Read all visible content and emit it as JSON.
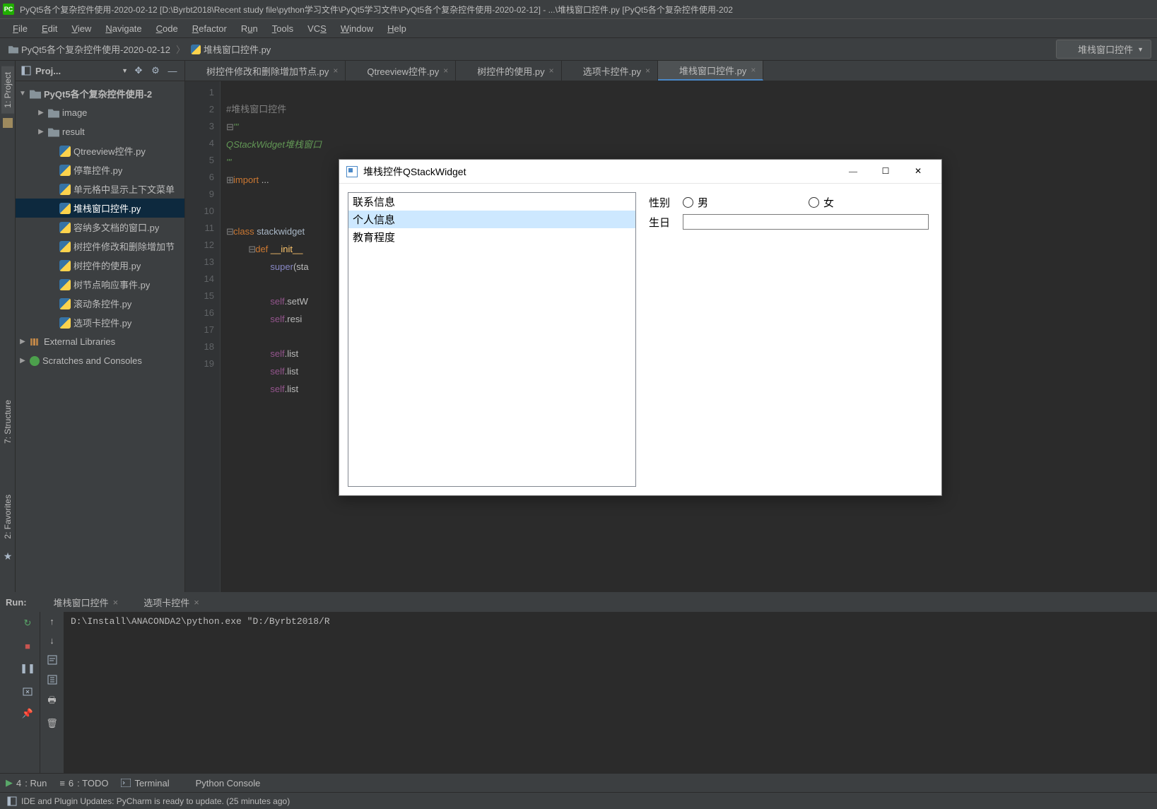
{
  "titlebar": {
    "app_icon": "PC",
    "text": "PyQt5各个复杂控件使用-2020-02-12 [D:\\Byrbt2018\\Recent study file\\python学习文件\\PyQt5学习文件\\PyQt5各个复杂控件使用-2020-02-12] - ...\\堆栈窗口控件.py [PyQt5各个复杂控件使用-202"
  },
  "menu": {
    "file": "File",
    "edit": "Edit",
    "view": "View",
    "navigate": "Navigate",
    "code": "Code",
    "refactor": "Refactor",
    "run": "Run",
    "tools": "Tools",
    "vcs": "VCS",
    "window": "Window",
    "help": "Help"
  },
  "breadcrumb": {
    "root": "PyQt5各个复杂控件使用-2020-02-12",
    "file": "堆栈窗口控件.py"
  },
  "run_config": {
    "selected": "堆栈窗口控件"
  },
  "left_tools": {
    "project": "1: Project",
    "structure": "7: Structure",
    "favorites": "2: Favorites"
  },
  "project_panel": {
    "header": "Proj..."
  },
  "tree": {
    "root": "PyQt5各个复杂控件使用-2",
    "items": [
      {
        "label": "image",
        "type": "folder",
        "indent": 1,
        "expander": "▶"
      },
      {
        "label": "result",
        "type": "folder",
        "indent": 1,
        "expander": "▶"
      },
      {
        "label": "Qtreeview控件.py",
        "type": "py",
        "indent": 2
      },
      {
        "label": "停靠控件.py",
        "type": "py",
        "indent": 2
      },
      {
        "label": "单元格中显示上下文菜单",
        "type": "py",
        "indent": 2
      },
      {
        "label": "堆栈窗口控件.py",
        "type": "py",
        "indent": 2,
        "selected": true
      },
      {
        "label": "容纳多文档的窗口.py",
        "type": "py",
        "indent": 2
      },
      {
        "label": "树控件修改和删除增加节",
        "type": "py",
        "indent": 2
      },
      {
        "label": "树控件的使用.py",
        "type": "py",
        "indent": 2
      },
      {
        "label": "树节点响应事件.py",
        "type": "py",
        "indent": 2
      },
      {
        "label": "滚动条控件.py",
        "type": "py",
        "indent": 2
      },
      {
        "label": "选项卡控件.py",
        "type": "py",
        "indent": 2
      }
    ],
    "external": "External Libraries",
    "scratches": "Scratches and Consoles"
  },
  "editor_tabs": [
    {
      "label": "树控件修改和删除增加节点.py"
    },
    {
      "label": "Qtreeview控件.py"
    },
    {
      "label": "树控件的使用.py"
    },
    {
      "label": "选项卡控件.py"
    },
    {
      "label": "堆栈窗口控件.py",
      "active": true
    }
  ],
  "editor": {
    "lines": [
      1,
      2,
      3,
      4,
      5,
      6,
      9,
      10,
      11,
      12,
      13,
      14,
      15,
      16,
      17,
      18,
      19
    ],
    "code": {
      "l1": "#堆栈窗口控件",
      "l2": "'''",
      "l3": "QStackWidget堆栈窗口",
      "l4": "'''",
      "l5_kw": "import",
      "l5_rest": " ...",
      "l10_kw": "class",
      "l10_name": " stackwidget",
      "l11_kw": "def",
      "l11_func": " __init__",
      "l12_super": "super",
      "l12_rest": "(sta",
      "l14_self": "self",
      "l14_call": ".setW",
      "l15_self": "self",
      "l15_call": ".resi",
      "l17_self": "self",
      "l17_call": ".list",
      "l18_self": "self",
      "l18_call": ".list",
      "l19_self": "self",
      "l19_call": ".list"
    }
  },
  "run": {
    "header": "Run:",
    "tabs": [
      {
        "label": "堆栈窗口控件"
      },
      {
        "label": "选项卡控件"
      }
    ],
    "output": "D:\\Install\\ANACONDA2\\python.exe \"D:/Byrbt2018/R"
  },
  "bottom": {
    "run": "4: Run",
    "todo": "6: TODO",
    "terminal": "Terminal",
    "pyconsole": "Python Console"
  },
  "status": {
    "text": "IDE and Plugin Updates: PyCharm is ready to update. (25 minutes ago)"
  },
  "qt": {
    "title": "堆栈控件QStackWidget",
    "list": [
      "联系信息",
      "个人信息",
      "教育程度"
    ],
    "selected_index": 1,
    "form": {
      "gender_label": "性别",
      "male": "男",
      "female": "女",
      "birthday_label": "生日",
      "birthday_value": ""
    }
  }
}
